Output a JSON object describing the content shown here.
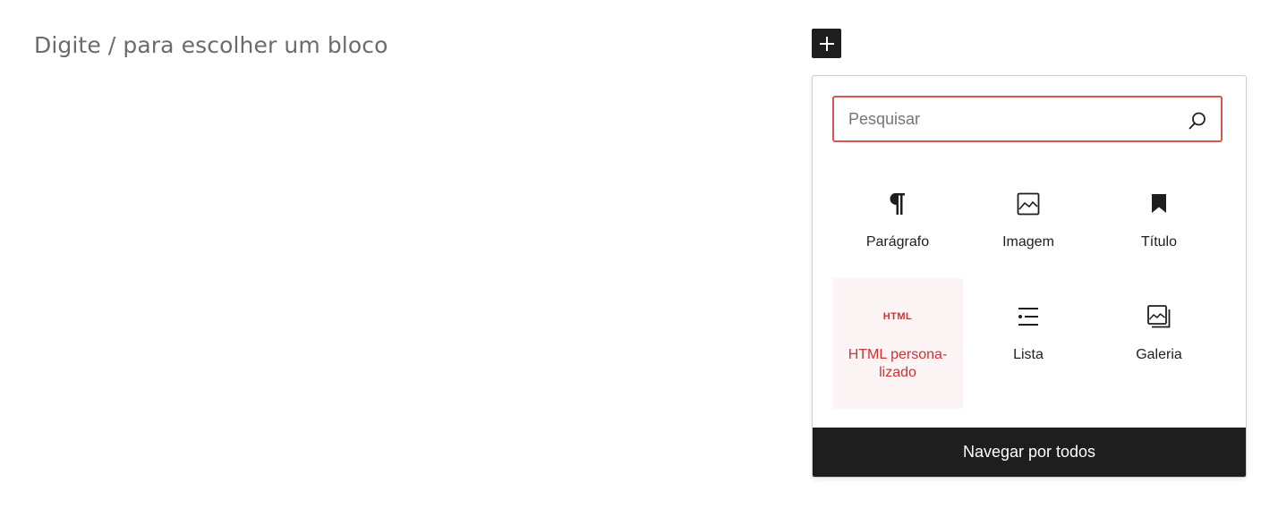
{
  "editor": {
    "placeholder": "Digite / para escolher um bloco"
  },
  "inserter": {
    "search_placeholder": "Pesquisar",
    "blocks": [
      {
        "label": "Parágrafo",
        "icon": "paragraph-icon"
      },
      {
        "label": "Imagem",
        "icon": "image-icon"
      },
      {
        "label": "Título",
        "icon": "bookmark-icon"
      },
      {
        "label": "HTML persona-\nlizado",
        "icon": "html-icon",
        "icon_text": "HTML"
      },
      {
        "label": "Lista",
        "icon": "list-icon"
      },
      {
        "label": "Galeria",
        "icon": "gallery-icon"
      }
    ],
    "browse_all": "Navegar por todos"
  },
  "colors": {
    "accent": "#cc3333",
    "dark": "#1e1e1e"
  }
}
